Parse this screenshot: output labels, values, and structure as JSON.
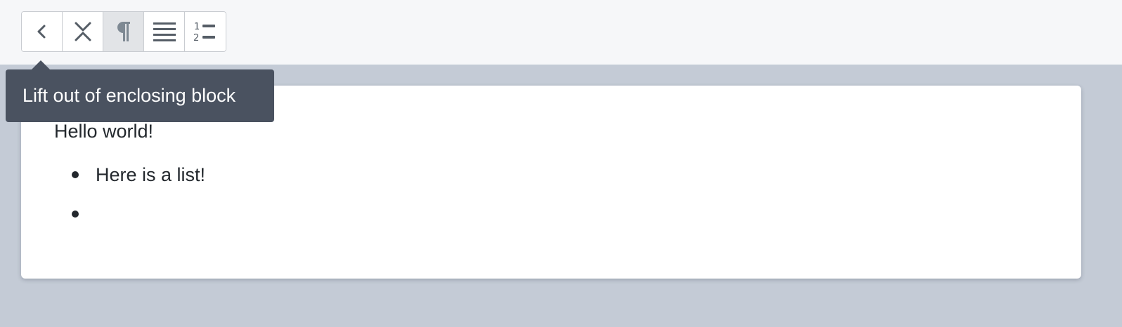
{
  "toolbar": {
    "buttons": [
      {
        "name": "back-button",
        "icon": "chevron-left-icon"
      },
      {
        "name": "collapse-button",
        "icon": "collapse-icon"
      },
      {
        "name": "paragraph-button",
        "icon": "pilcrow-icon",
        "active": true
      },
      {
        "name": "unordered-list-button",
        "icon": "justify-lines-icon"
      },
      {
        "name": "ordered-list-button",
        "icon": "numbered-list-icon"
      }
    ],
    "icon_color": "#555d66",
    "active_icon_color": "#7e8993"
  },
  "tooltip": {
    "text": "Lift out of enclosing block",
    "background": "#4a5260"
  },
  "editor": {
    "paragraph": "Hello world!",
    "list_items": [
      "Here is a list!",
      ""
    ]
  },
  "colors": {
    "page_background": "#c4cbd6",
    "header_background": "#f6f7f9",
    "text": "#23282d"
  }
}
